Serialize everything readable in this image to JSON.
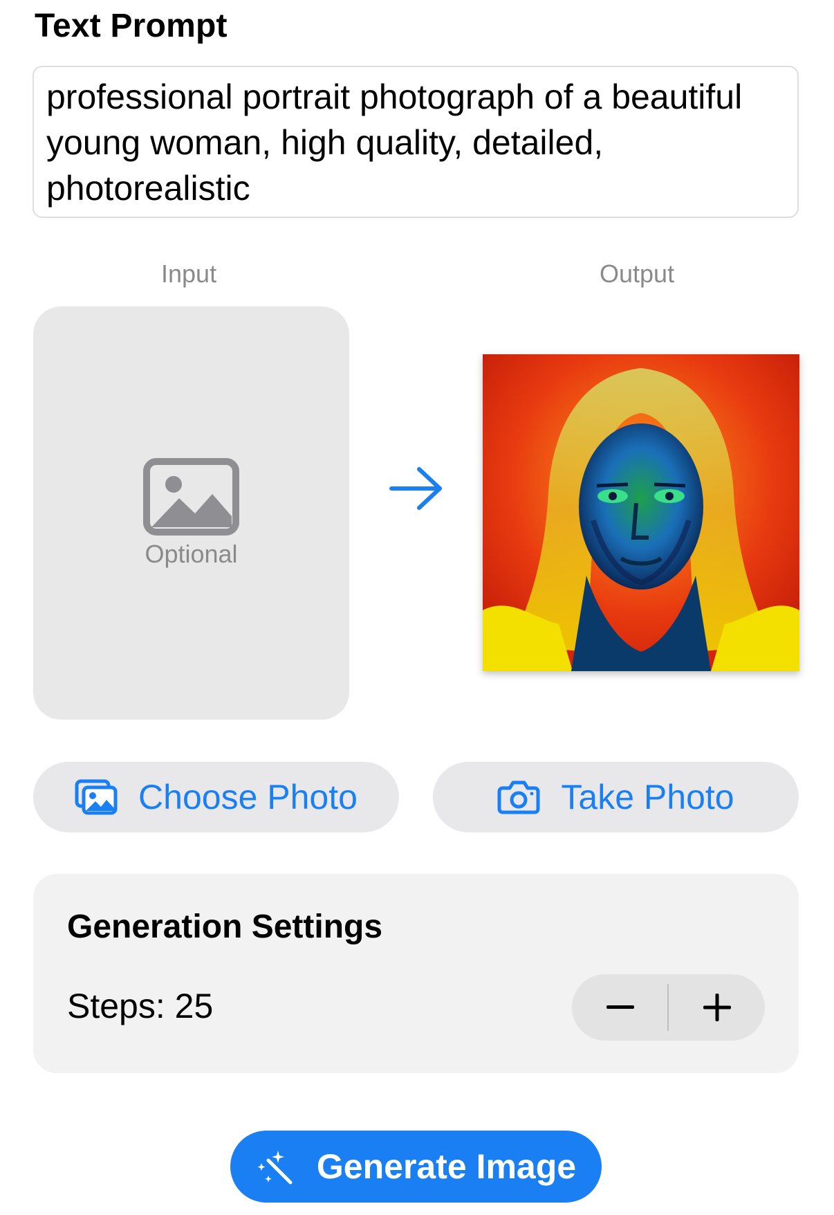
{
  "prompt_section": {
    "title": "Text Prompt",
    "value": "professional portrait photograph of a beautiful young woman, high quality, detailed, photorealistic"
  },
  "input_panel": {
    "caption": "Input",
    "placeholder_label": "Optional",
    "icon": "photo-icon"
  },
  "output_panel": {
    "caption": "Output"
  },
  "arrow_icon": "arrow-right-icon",
  "buttons": {
    "choose_photo": {
      "label": "Choose Photo",
      "icon": "photo-library-icon"
    },
    "take_photo": {
      "label": "Take Photo",
      "icon": "camera-icon"
    },
    "generate": {
      "label": "Generate Image",
      "icon": "magic-wand-icon"
    }
  },
  "settings": {
    "title": "Generation Settings",
    "steps_label": "Steps: 25",
    "steps_value": 25,
    "stepper": {
      "minus_icon": "minus-icon",
      "plus_icon": "plus-icon"
    }
  },
  "colors": {
    "accent": "#1a7ff2",
    "button_bg": "#e8e8eb",
    "card_bg": "#f2f2f2",
    "placeholder_bg": "#e8e8e8",
    "secondary_text": "#8a8a8a"
  }
}
